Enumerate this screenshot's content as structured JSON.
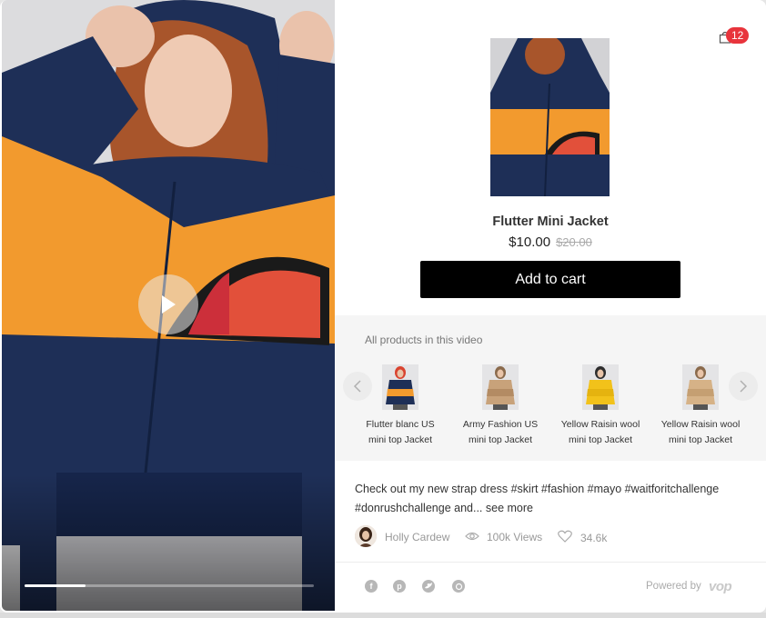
{
  "video": {
    "progress": 0.21
  },
  "cart": {
    "count": "12"
  },
  "product": {
    "name": "Flutter Mini Jacket",
    "price": "$10.00",
    "old_price": "$20.00",
    "add_to_cart_label": "Add to cart"
  },
  "all_products": {
    "title": "All products in this video",
    "items": [
      {
        "line1": "Flutter blanc US",
        "line2": "mini top Jacket",
        "colors": [
          "#1e2f57",
          "#f29a2e",
          "#d9432f"
        ]
      },
      {
        "line1": "Army Fashion US",
        "line2": "mini top Jacket",
        "colors": [
          "#c8a27a",
          "#b38b63",
          "#8a6a4c"
        ]
      },
      {
        "line1": "Yellow Raisin wool",
        "line2": "mini top Jacket",
        "colors": [
          "#f2c21a",
          "#e5b30f",
          "#2d2d2d"
        ]
      },
      {
        "line1": "Yellow Raisin wool",
        "line2": "mini top Jacket",
        "colors": [
          "#d6b287",
          "#c59f72",
          "#8a6a4c"
        ]
      }
    ]
  },
  "caption": {
    "text": "Check out my new  strap dress #skirt #fashion #mayo #waitforitchallenge #donrushchallenge and...",
    "more": "see more"
  },
  "meta": {
    "author": "Holly Cardew",
    "views": "100k Views",
    "likes": "34.6k"
  },
  "share": {
    "icons": [
      "facebook-icon",
      "pinterest-icon",
      "twitter-icon",
      "link-icon"
    ]
  },
  "footer": {
    "powered_by": "Powered by",
    "brand": "vop"
  },
  "colors": {
    "navy": "#1e2f57",
    "orange": "#f29a2e",
    "red": "#e2503a",
    "badge": "#e8343c",
    "button": "#000000"
  }
}
